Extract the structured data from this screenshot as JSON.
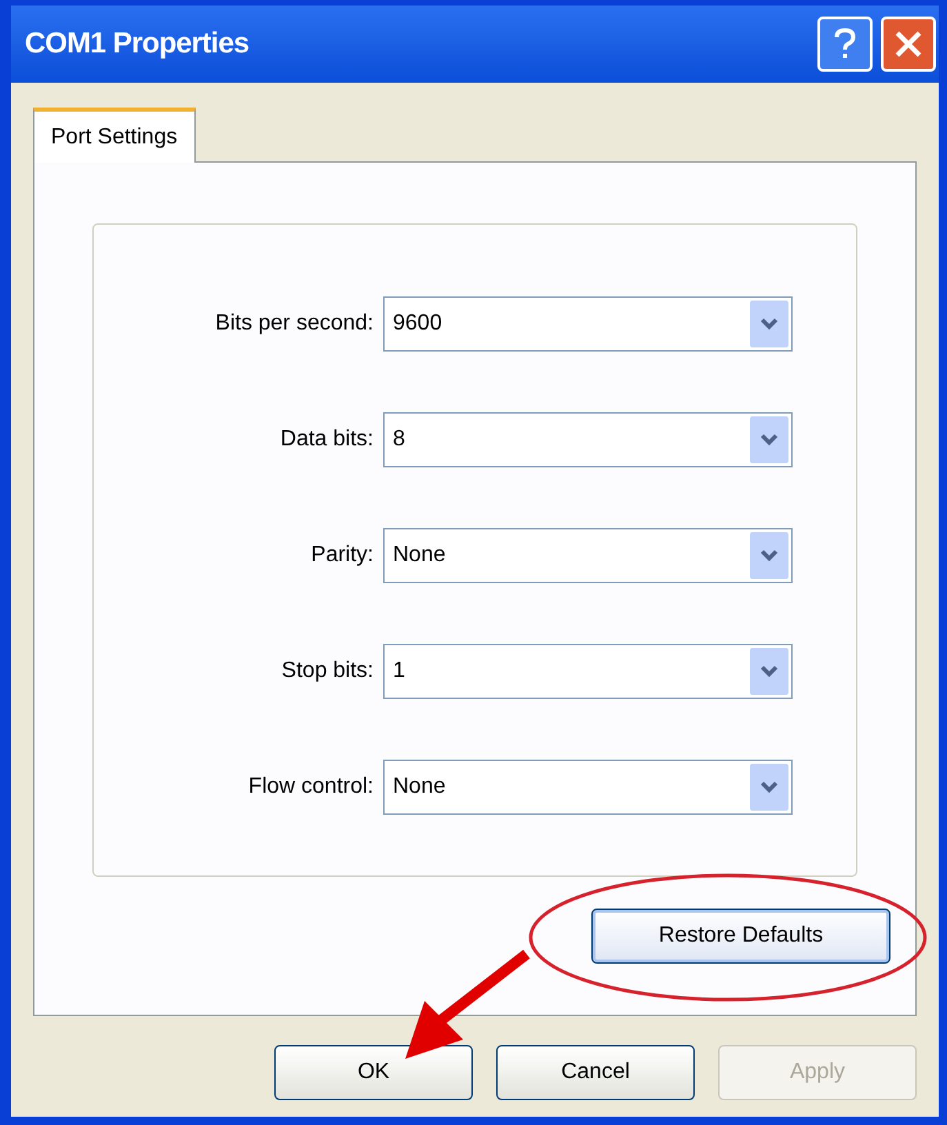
{
  "window": {
    "title": "COM1 Properties"
  },
  "tabs": [
    {
      "label": "Port Settings",
      "selected": true
    }
  ],
  "settings": [
    {
      "label": "Bits per second:",
      "value": "9600"
    },
    {
      "label": "Data bits:",
      "value": "8"
    },
    {
      "label": "Parity:",
      "value": "None"
    },
    {
      "label": "Stop bits:",
      "value": "1"
    },
    {
      "label": "Flow control:",
      "value": "None"
    }
  ],
  "restore_button": {
    "label": "Restore Defaults"
  },
  "buttons": [
    {
      "label": "OK",
      "disabled": false
    },
    {
      "label": "Cancel",
      "disabled": false
    },
    {
      "label": "Apply",
      "disabled": true
    }
  ]
}
